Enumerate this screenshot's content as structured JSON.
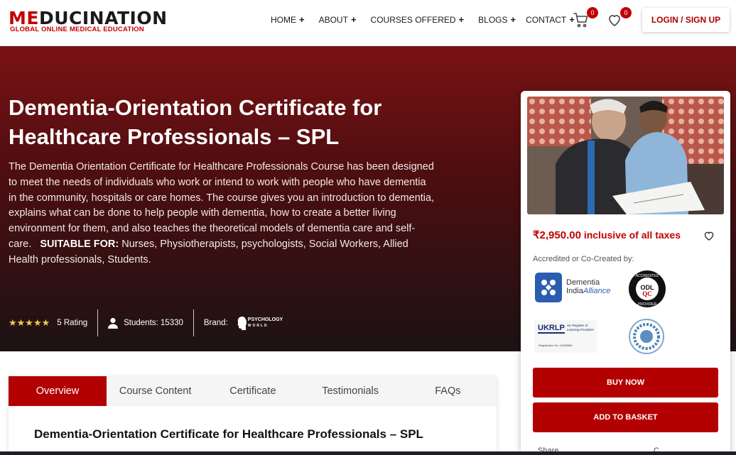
{
  "logo": {
    "main_prefix": "ME",
    "main_rest": "DUCINATION",
    "subtitle": "GLOBAL ONLINE MEDICAL EDUCATION"
  },
  "nav": {
    "items": [
      {
        "label": "HOME"
      },
      {
        "label": "ABOUT"
      },
      {
        "label": "COURSES OFFERED"
      },
      {
        "label": "BLOGS"
      },
      {
        "label": "CONTACT"
      }
    ],
    "plus": "+"
  },
  "cart": {
    "count": "0"
  },
  "wishlist": {
    "count": "0"
  },
  "header": {
    "login_label": "LOGIN / SIGN UP"
  },
  "hero": {
    "title": "Dementia-Orientation Certificate for Healthcare Professionals – SPL",
    "description": "The Dementia Orientation Certificate for Healthcare Professionals Course has been designed to meet the needs of individuals who work or intend to work with people who have dementia in the community, hospitals or care homes. The course gives you an introduction to dementia, explains what can be done to help people with dementia, how to create a better living environment for them, and also teaches the theoretical models of dementia care and self-care.",
    "suitable_label": "SUITABLE FOR:",
    "suitable_text": "Nurses, Physiotherapists, psychologists, Social Workers, Allied Health professionals, Students.",
    "rating_stars": "★★★★★",
    "rating_label": "5 Rating",
    "students": "Students: 15330",
    "brand_label": "Brand:",
    "brand_name_line1": "PSYCHOLOGY",
    "brand_name_line2": "WORLD"
  },
  "tabs": {
    "items": [
      {
        "label": "Overview"
      },
      {
        "label": "Course Content"
      },
      {
        "label": "Certificate"
      },
      {
        "label": "Testimonials"
      },
      {
        "label": "FAQs"
      }
    ],
    "active": 0,
    "heading": "Dementia-Orientation Certificate for Healthcare Professionals – SPL"
  },
  "sidebar": {
    "price": "₹2,950.00",
    "price_note": "inclusive of all taxes",
    "accredited_label": "Accredited or Co-Created by:",
    "accreditors": {
      "dementia_line1": "Dementia",
      "dementia_line2": "India",
      "dementia_line2b": "Alliance",
      "odl_top": "ACCREDITED",
      "odl_mid": "ODL",
      "odl_qc": "QC",
      "odl_bottom": "PROVIDER",
      "ukrlp_title": "UKRLP",
      "ukrlp_sub": "UK Register of Learning Providers",
      "ukrlp_reg": "Registration No: 10055566"
    },
    "buy_label": "BUY NOW",
    "basket_label": "ADD TO BASKET",
    "share_label": "Share Course",
    "compare_label": "C"
  },
  "colors": {
    "brand_red": "#b30000",
    "hero_dark": "#4a0e10",
    "star": "#f2c94c"
  }
}
